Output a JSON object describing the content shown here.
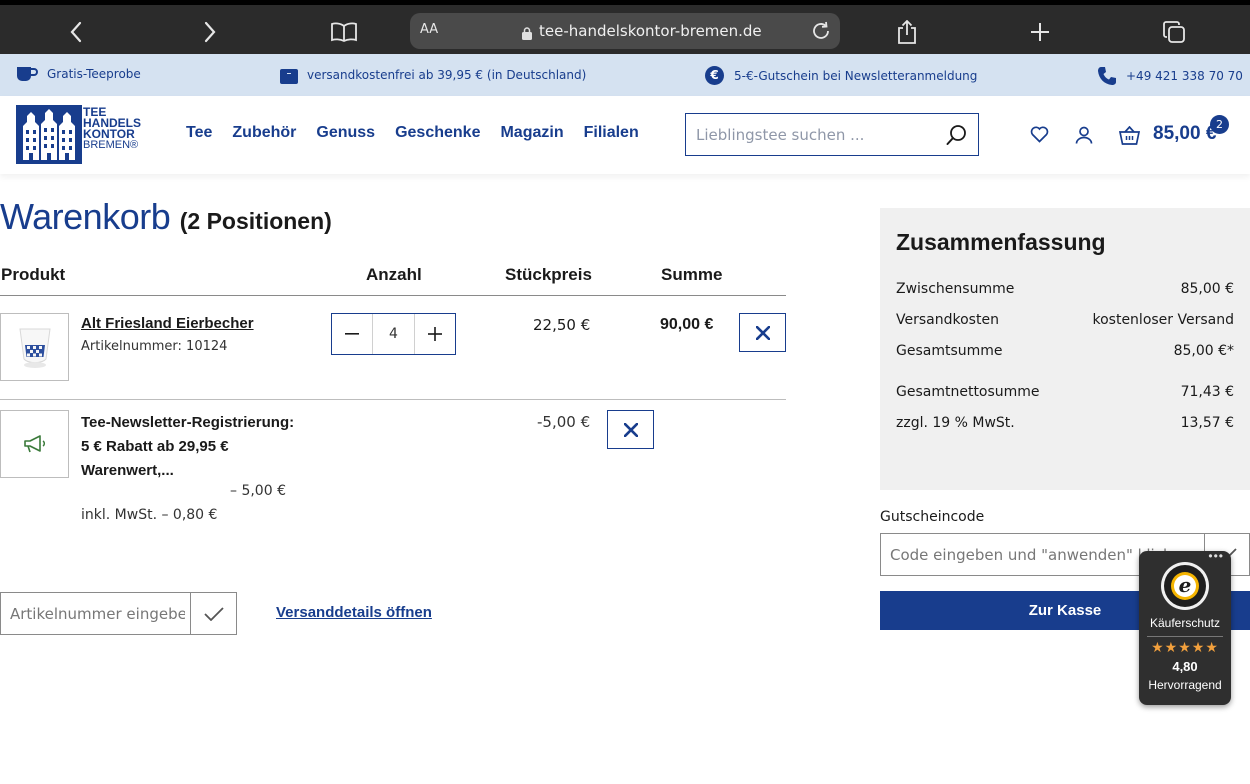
{
  "browser": {
    "text_size_label": "AA",
    "url": "tee-handelskontor-bremen.de"
  },
  "promo": {
    "sample": "Gratis-Teeprobe",
    "shipping": "versandkostenfrei ab 39,95 € (in Deutschland)",
    "voucher_symbol": "€",
    "voucher": "5-€-Gutschein bei Newsletteranmeldung",
    "phone": "+49 421 338 70 70"
  },
  "header": {
    "logo_lines": [
      "TEE",
      "HANDELS",
      "KONTOR",
      "BREMEN®"
    ],
    "nav": [
      "Tee",
      "Zubehör",
      "Genuss",
      "Geschenke",
      "Magazin",
      "Filialen"
    ],
    "search_placeholder": "Lieblingstee suchen ...",
    "cart_total": "85,00 €",
    "cart_count": "2"
  },
  "cart": {
    "title": "Warenkorb",
    "count_label": "(2 Positionen)",
    "columns": {
      "product": "Produkt",
      "quantity": "Anzahl",
      "unit_price": "Stückpreis",
      "total": "Summe"
    },
    "items": [
      {
        "name": "Alt Friesland Eierbecher",
        "sku": "Artikelnummer: 10124",
        "quantity": "4",
        "unit_price": "22,50 €",
        "total": "90,00 €"
      }
    ],
    "promotion": {
      "name": "Tee-Newsletter-Registrierung: 5 € Rabatt ab 29,95 € Warenwert,...",
      "price": "– 5,00 €",
      "tax": "inkl. MwSt. – 0,80 €",
      "unit_price": "-5,00 €"
    },
    "sku_input_placeholder": "Artikelnummer eingeben ...",
    "shipping_link": "Versanddetails öffnen"
  },
  "summary": {
    "title": "Zusammenfassung",
    "rows": [
      {
        "label": "Zwischensumme",
        "value": "85,00 €"
      },
      {
        "label": "Versandkosten",
        "value": "kostenloser Versand"
      },
      {
        "label": "Gesamtsumme",
        "value": "85,00 €*"
      },
      {
        "label": "Gesamtnettosumme",
        "value": "71,43 €"
      },
      {
        "label": "zzgl. 19 % MwSt.",
        "value": "13,57 €"
      }
    ],
    "coupon_label": "Gutscheincode",
    "coupon_placeholder": "Code eingeben und \"anwenden\" klicken",
    "checkout": "Zur Kasse"
  },
  "trusted_shops": {
    "menu": "•••",
    "seal_letter": "e",
    "label": "Käuferschutz",
    "stars": "★★★★★",
    "rating": "4,80",
    "grade": "Hervorragend"
  },
  "colors": {
    "brand_blue": "#183d8d",
    "promo_bar": "#d5e2f1",
    "summary_bg": "#f0f0f0",
    "star": "#f2a03d"
  }
}
